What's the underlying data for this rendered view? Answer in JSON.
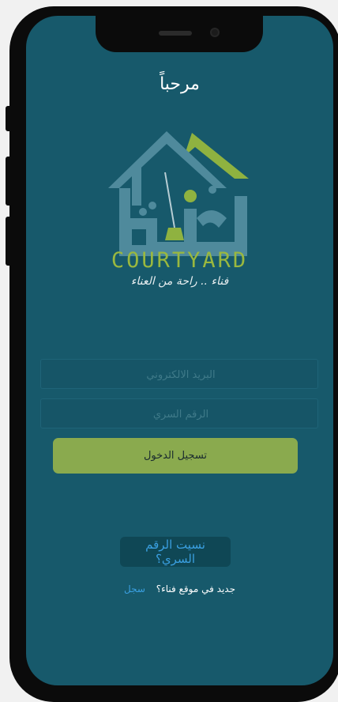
{
  "header": {
    "welcome": "مرحباً"
  },
  "logo": {
    "brand": "COURTYARD",
    "tagline": "فناء .. راحة من العناء"
  },
  "form": {
    "email_placeholder": "البريد الالكتروني",
    "password_placeholder": "الرقم السري",
    "login_label": "تسجيل الدخول"
  },
  "footer": {
    "forgot_label": "نسيت الرقم السري؟",
    "new_user_text": "جديد في موقع فناء؟",
    "signup_label": "سجل"
  },
  "colors": {
    "background": "#17596b",
    "accent_green": "#8aaa4e",
    "logo_blue": "#4f8a9c",
    "link_blue": "#3a9fe0"
  }
}
